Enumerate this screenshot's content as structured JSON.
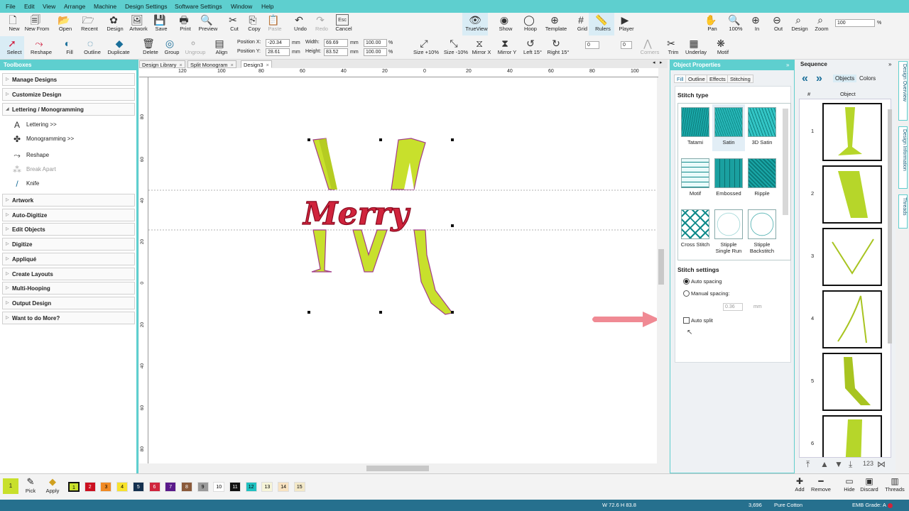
{
  "menu": [
    "File",
    "Edit",
    "View",
    "Arrange",
    "Machine",
    "Design Settings",
    "Software Settings",
    "Window",
    "Help"
  ],
  "toolbar1": [
    {
      "label": "New",
      "icon": "new-file-icon"
    },
    {
      "label": "New From",
      "icon": "new-from-icon"
    },
    {
      "label": "Open",
      "icon": "open-folder-icon"
    },
    {
      "label": "Recent",
      "icon": "recent-icon"
    },
    {
      "label": "Design",
      "icon": "design-icon"
    },
    {
      "label": "Artwork",
      "icon": "artwork-icon"
    },
    {
      "label": "Save",
      "icon": "save-icon"
    },
    {
      "label": "Print",
      "icon": "print-icon"
    },
    {
      "label": "Preview",
      "icon": "preview-icon"
    },
    {
      "label": "Cut",
      "icon": "cut-icon"
    },
    {
      "label": "Copy",
      "icon": "copy-icon"
    },
    {
      "label": "Paste",
      "icon": "paste-icon"
    },
    {
      "label": "Undo",
      "icon": "undo-icon"
    },
    {
      "label": "Redo",
      "icon": "redo-icon"
    },
    {
      "label": "Cancel",
      "icon": "cancel-icon"
    },
    {
      "label": "TrueView",
      "icon": "trueview-icon"
    },
    {
      "label": "Show",
      "icon": "show-icon"
    },
    {
      "label": "Hoop",
      "icon": "hoop-icon"
    },
    {
      "label": "Template",
      "icon": "template-icon"
    },
    {
      "label": "Grid",
      "icon": "grid-icon"
    },
    {
      "label": "Rulers",
      "icon": "rulers-icon"
    },
    {
      "label": "Player",
      "icon": "player-icon"
    },
    {
      "label": "Pan",
      "icon": "pan-icon"
    },
    {
      "label": "100%",
      "icon": "zoom-100-icon"
    },
    {
      "label": "In",
      "icon": "zoom-in-icon"
    },
    {
      "label": "Out",
      "icon": "zoom-out-icon"
    },
    {
      "label": "Design",
      "icon": "zoom-design-icon"
    },
    {
      "label": "Zoom",
      "icon": "zoom-icon"
    }
  ],
  "cancel_key": "Esc",
  "zoom_value": "100",
  "zoom_unit": "%",
  "toolbar2": [
    {
      "label": "Select",
      "icon": "select-arrow-icon"
    },
    {
      "label": "Reshape",
      "icon": "reshape-icon"
    },
    {
      "label": "Fill",
      "icon": "fill-icon"
    },
    {
      "label": "Outline",
      "icon": "outline-icon"
    },
    {
      "label": "Duplicate",
      "icon": "duplicate-icon"
    },
    {
      "label": "Delete",
      "icon": "delete-icon"
    },
    {
      "label": "Group",
      "icon": "group-icon"
    },
    {
      "label": "Ungroup",
      "icon": "ungroup-icon"
    },
    {
      "label": "Align",
      "icon": "align-icon"
    },
    {
      "label": "Size +10%",
      "icon": "size-plus-icon"
    },
    {
      "label": "Size -10%",
      "icon": "size-minus-icon"
    },
    {
      "label": "Mirror X",
      "icon": "mirror-x-icon"
    },
    {
      "label": "Mirror Y",
      "icon": "mirror-y-icon"
    },
    {
      "label": "Left 15°",
      "icon": "rotate-left-icon"
    },
    {
      "label": "Right 15°",
      "icon": "rotate-right-icon"
    },
    {
      "label": "Corners",
      "icon": "corners-icon"
    },
    {
      "label": "Trim",
      "icon": "trim-icon"
    },
    {
      "label": "Underlay",
      "icon": "underlay-icon"
    },
    {
      "label": "Motif",
      "icon": "motif-icon"
    }
  ],
  "position": {
    "x_label": "Position X:",
    "x": "-20.34",
    "y_label": "Position Y:",
    "y": "28.61",
    "unit": "mm",
    "w_label": "Width:",
    "w": "69.69",
    "h_label": "Height:",
    "h": "83.52",
    "wpct": "100.00",
    "hpct": "100.00",
    "pct": "%"
  },
  "rotate_value": "0",
  "slant_value": "0",
  "toolboxes": {
    "title": "Toolboxes",
    "sections": [
      "Manage Designs",
      "Customize Design",
      "Lettering / Monogramming"
    ],
    "sub_items": [
      {
        "label": "Lettering >>",
        "icon": "lettering-icon",
        "dis": false
      },
      {
        "label": "Monogramming >>",
        "icon": "monogramming-icon",
        "dis": false
      },
      {
        "label": "Reshape",
        "icon": "reshape-icon",
        "dis": false
      },
      {
        "label": "Break Apart",
        "icon": "break-apart-icon",
        "dis": true
      },
      {
        "label": "Knife",
        "icon": "knife-icon",
        "dis": false
      }
    ],
    "more_sections": [
      "Artwork",
      "Auto-Digitize",
      "Edit Objects",
      "Digitize",
      "Appliqué",
      "Create Layouts",
      "Multi-Hooping",
      "Output Design",
      "Want to do More?"
    ]
  },
  "doc_tabs": [
    "Design Library",
    "Split Monogram",
    "Design3"
  ],
  "ruler_top": [
    "120",
    "100",
    "80",
    "60",
    "40",
    "20",
    "0",
    "20",
    "40",
    "60",
    "80",
    "100"
  ],
  "ruler_left": [
    "80",
    "60",
    "40",
    "20",
    "0",
    "20",
    "40",
    "60",
    "80"
  ],
  "canvas": {
    "monogram_letter": "M",
    "word": "Merry",
    "accent_color": "#c8e02c",
    "word_color": "#d0243c"
  },
  "object_properties": {
    "title": "Object Properties",
    "tabs": [
      "Fill",
      "Outline",
      "Effects",
      "Stitching"
    ],
    "stitch_type_label": "Stitch type",
    "stitch_types": [
      {
        "name": "Tatami",
        "l2": ""
      },
      {
        "name": "Satin",
        "l2": ""
      },
      {
        "name": "3D Satin",
        "l2": ""
      },
      {
        "name": "Motif",
        "l2": ""
      },
      {
        "name": "Embossed",
        "l2": ""
      },
      {
        "name": "Ripple",
        "l2": ""
      },
      {
        "name": "Cross Stitch",
        "l2": ""
      },
      {
        "name": "Stipple",
        "l2": "Single Run"
      },
      {
        "name": "Stipple",
        "l2": "Backstitch"
      }
    ],
    "settings_label": "Stitch settings",
    "auto_spacing": "Auto spacing",
    "manual_spacing": "Manual spacing:",
    "spacing_value": "0.36",
    "spacing_unit": "mm",
    "auto_split": "Auto split"
  },
  "sequence": {
    "title": "Sequence",
    "tab_objects": "Objects",
    "tab_colors": "Colors",
    "col_num": "#",
    "col_obj": "Object",
    "rows": [
      "1",
      "2",
      "3",
      "4",
      "5",
      "6"
    ]
  },
  "side_tabs": [
    "Design Overview",
    "Design Information",
    "Threads"
  ],
  "bottom": {
    "active_color_num": "1",
    "pick": "Pick",
    "apply": "Apply",
    "colors": [
      {
        "n": "1",
        "c": "#c8e02c",
        "t": "#000"
      },
      {
        "n": "2",
        "c": "#cc1020",
        "t": "#fff"
      },
      {
        "n": "3",
        "c": "#f08a24",
        "t": "#000"
      },
      {
        "n": "4",
        "c": "#f7e22c",
        "t": "#000"
      },
      {
        "n": "5",
        "c": "#14304f",
        "t": "#fff"
      },
      {
        "n": "6",
        "c": "#d0243c",
        "t": "#fff"
      },
      {
        "n": "7",
        "c": "#5a1a8a",
        "t": "#fff"
      },
      {
        "n": "8",
        "c": "#8a5a3a",
        "t": "#fff"
      },
      {
        "n": "9",
        "c": "#9a9a9a",
        "t": "#000"
      },
      {
        "n": "10",
        "c": "#ffffff",
        "t": "#000"
      },
      {
        "n": "11",
        "c": "#111111",
        "t": "#fff"
      },
      {
        "n": "12",
        "c": "#20c0c0",
        "t": "#000"
      },
      {
        "n": "13",
        "c": "#f6f4d8",
        "t": "#000"
      },
      {
        "n": "14",
        "c": "#f8e2c0",
        "t": "#000"
      },
      {
        "n": "15",
        "c": "#f3e8c8",
        "t": "#000"
      }
    ],
    "actions": [
      "Add",
      "Remove",
      "Hide",
      "Discard",
      "Threads"
    ]
  },
  "status": {
    "dims": "W 72.6 H 83.8",
    "stitches": "3,696",
    "thread": "Pure Cotton",
    "grade": "EMB Grade: A"
  }
}
